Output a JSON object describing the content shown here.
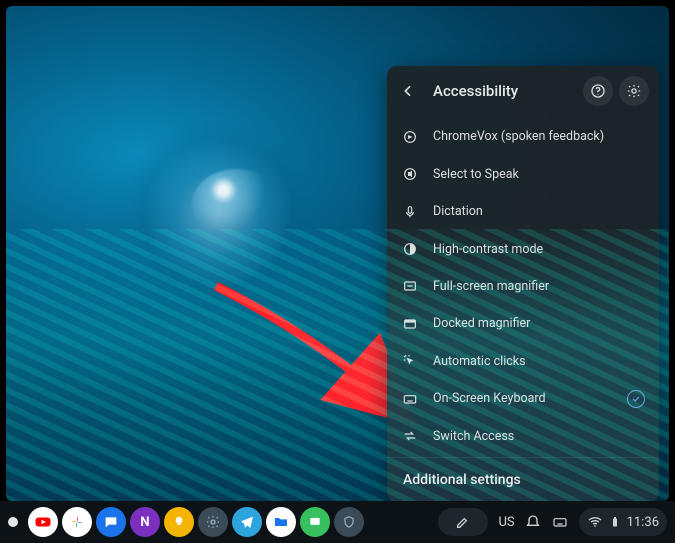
{
  "panel": {
    "title": "Accessibility",
    "items": [
      {
        "label": "ChromeVox (spoken feedback)"
      },
      {
        "label": "Select to Speak"
      },
      {
        "label": "Dictation"
      },
      {
        "label": "High-contrast mode"
      },
      {
        "label": "Full-screen magnifier"
      },
      {
        "label": "Docked magnifier"
      },
      {
        "label": "Automatic clicks"
      },
      {
        "label": "On-Screen Keyboard"
      },
      {
        "label": "Switch Access"
      }
    ],
    "footer": "Additional settings"
  },
  "tray": {
    "ime": "US",
    "time": "11:36"
  },
  "shelf_apps": [
    {
      "name": "youtube",
      "bg": "#ffffff"
    },
    {
      "name": "photos",
      "bg": "#ffffff"
    },
    {
      "name": "messages",
      "bg": "#1a73e8"
    },
    {
      "name": "onenote",
      "bg": "#7b2fbf"
    },
    {
      "name": "keep",
      "bg": "#f5b400"
    },
    {
      "name": "settings",
      "bg": "#3b4a57"
    },
    {
      "name": "telegram",
      "bg": "#2da5dc"
    },
    {
      "name": "files",
      "bg": "#ffffff"
    },
    {
      "name": "app-green",
      "bg": "#36c05e"
    },
    {
      "name": "brave",
      "bg": "#3b4a57"
    }
  ]
}
